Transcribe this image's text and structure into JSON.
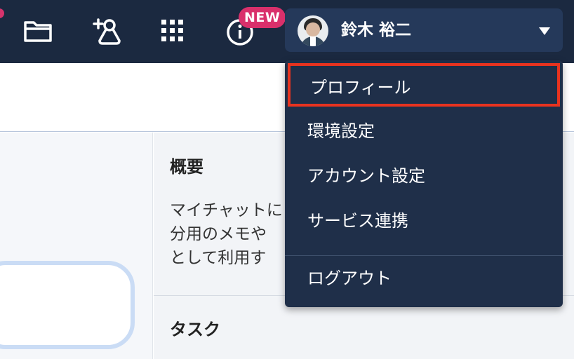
{
  "topbar": {
    "new_badge": "NEW",
    "icons": [
      "notification-dot",
      "folder-icon",
      "add-contact-icon",
      "app-grid-icon",
      "info-icon"
    ],
    "bg_color": "#1b2940",
    "badge_color": "#d9306b"
  },
  "user": {
    "name": "鈴木 裕二"
  },
  "dropdown": {
    "items": [
      {
        "label": "プロフィール",
        "highlighted": true
      },
      {
        "label": "環境設定"
      },
      {
        "label": "アカウント設定"
      },
      {
        "label": "サービス連携"
      }
    ],
    "logout_label": "ログアウト",
    "highlight_color": "#e8331f"
  },
  "main": {
    "overview_title": "概要",
    "overview_text_lines": [
      "マイチャットに",
      "分用のメモや",
      "として利用す"
    ],
    "task_title": "タスク"
  }
}
